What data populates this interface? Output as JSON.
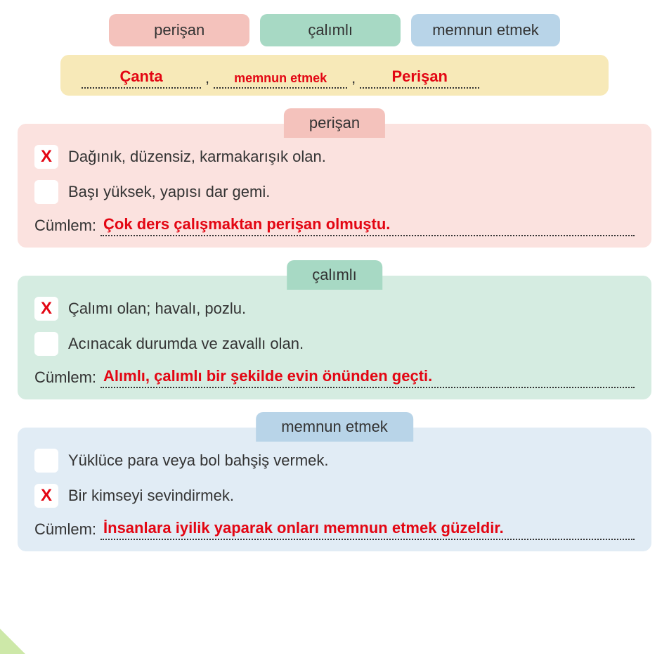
{
  "top_pills": {
    "red": "perişan",
    "green": "çalımlı",
    "blue": "memnun etmek"
  },
  "answer_strip": {
    "blank1": "Çanta",
    "sep1": ",",
    "blank2": "memnun etmek",
    "sep2": ",",
    "blank3": "Perişan"
  },
  "sections": {
    "perisan": {
      "header": "perişan",
      "opt1": {
        "mark": "X",
        "text": "Dağınık, düzensiz, karmakarışık olan."
      },
      "opt2": {
        "mark": "",
        "text": "Başı yüksek, yapısı dar gemi."
      },
      "cumlem_label": "Cümlem:",
      "cumlem_answer": "Çok ders çalışmaktan perişan olmuştu."
    },
    "calimli": {
      "header": "çalımlı",
      "opt1": {
        "mark": "X",
        "text": "Çalımı olan; havalı, pozlu."
      },
      "opt2": {
        "mark": "",
        "text": "Acınacak durumda ve zavallı olan."
      },
      "cumlem_label": "Cümlem:",
      "cumlem_answer": "Alımlı, çalımlı bir şekilde evin önünden geçti."
    },
    "memnun": {
      "header": "memnun etmek",
      "opt1": {
        "mark": "",
        "text": "Yüklüce para veya bol bahşiş vermek."
      },
      "opt2": {
        "mark": "X",
        "text": "Bir kimseyi sevindirmek."
      },
      "cumlem_label": "Cümlem:",
      "cumlem_answer": "İnsanlara iyilik yaparak onları memnun etmek güzeldir."
    }
  }
}
